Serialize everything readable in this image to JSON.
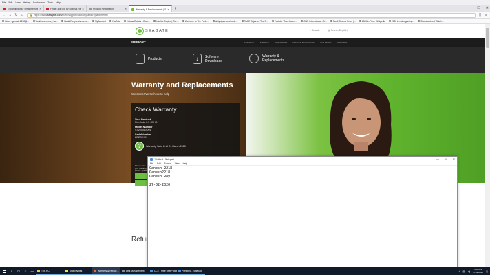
{
  "browser": {
    "menu": [
      "File",
      "Edit",
      "View",
      "History",
      "Bookmarks",
      "Tools",
      "Help"
    ],
    "tabs": [
      {
        "label": "Expanding your crisis member…",
        "active": false,
        "color": "#c22"
      },
      {
        "label": "Finger-gori not by Boxes's Rec…",
        "active": false,
        "color": "#c22"
      },
      {
        "label": "Product Registration",
        "active": false,
        "color": "#999"
      },
      {
        "label": "Warranty & Replacements | S…",
        "active": true,
        "color": "#6ebe44"
      }
    ],
    "url_prefix": "https://www.",
    "url_domain": "seagate.com",
    "url_path": "/in/en/support/warranty-and-replacements/",
    "bookmarks": [
      "Inbox - ganesh.2218@…",
      "Tamil new money, ho…",
      "Ideal&Responsiveness…",
      "MyAccount",
      "YouTube",
      "Kotasa Rotator - Dow…",
      "Into the Depths | The…",
      "Welcome to The Perfo…",
      "dailypigsa.com/conte…",
      "PAGE Rajas.io | The S…",
      "Youtube Video Downl…",
      "CNN International - B…",
      "Tamil Cinema News |…",
      "2020 in Film - Wikipedia",
      "2020 in video gaming…",
      "Download and Watch…"
    ]
  },
  "seagate": {
    "logo_text": "SEAGATE",
    "header_links": [
      "Search",
      "Select (English)"
    ],
    "support_label": "SUPPORT",
    "support_nav": [
      "EXTERNAL",
      "INTERNAL",
      "ENTERPRISE",
      "DEVICES & SOFTWARE",
      "OUR STORY",
      "PARTNERS"
    ],
    "mega": [
      {
        "l1": "Products",
        "l2": ""
      },
      {
        "l1": "Software",
        "l2": "Downloads"
      },
      {
        "l1": "Warranty &",
        "l2": "Replacements"
      }
    ],
    "hero_title": "Warranty and Replacements",
    "hero_sub": "Welcome! We're here to help",
    "check": {
      "title": "Check Warranty",
      "product_label": "Your Product",
      "product_value": "FireCuda 2.5 SSHD",
      "model_label": "Model Number",
      "model_value": "ST2000LX001",
      "serial_label": "SerialNumber",
      "serial_value": "ZDZ2ZH2J",
      "valid_text": "Warranty Valid Until 24 March 2025",
      "note": "Please note: your warranty period… please read…"
    },
    "returns": "Return"
  },
  "notepad": {
    "title": "*Untitled - Notepad",
    "menu": [
      "File",
      "Edit",
      "Format",
      "View",
      "Help"
    ],
    "lines": [
      "Ganesh_2218",
      "Ganesh2218",
      "Ganesh Roy",
      "",
      "27-02-2020"
    ]
  },
  "taskbar": {
    "apps": [
      {
        "label": "This PC",
        "color": "#f2c14e"
      },
      {
        "label": "Sticky Notes",
        "color": "#f2e14e"
      },
      {
        "label": "Warranty & Replac…",
        "color": "#e66a2c",
        "active": true
      },
      {
        "label": "Disk Management",
        "color": "#888"
      },
      {
        "label": "CCE - Free UserProfile…",
        "color": "#4a8fd8"
      },
      {
        "label": "*Untitled - Notepad",
        "color": "#4a8fd8"
      }
    ],
    "time": "3:00 PM",
    "date": "27-02-2020"
  }
}
